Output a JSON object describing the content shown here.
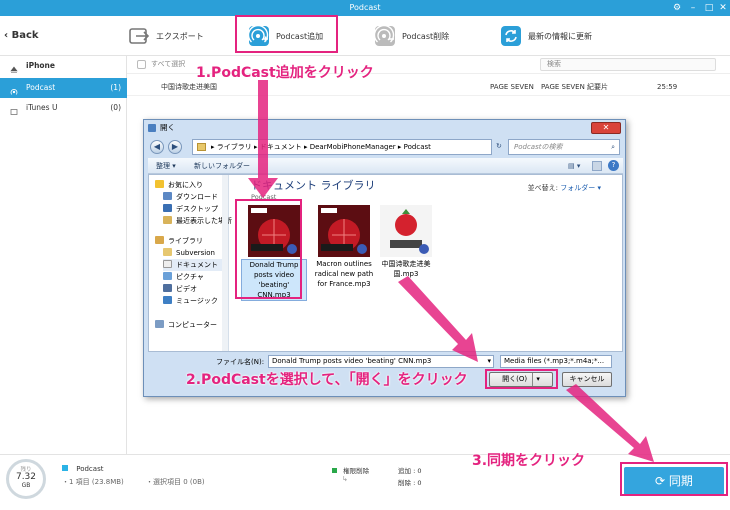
{
  "window": {
    "title": "Podcast"
  },
  "toolbar": {
    "back_label": "Back",
    "export_label": "エクスポート",
    "add_label": "Podcast追加",
    "delete_label": "Podcast削除",
    "refresh_label": "最新の情報に更新"
  },
  "sidebar": {
    "device": "iPhone",
    "items": [
      {
        "label": "Podcast",
        "count": "(1)"
      },
      {
        "label": "iTunes U",
        "count": "(0)"
      }
    ]
  },
  "list": {
    "select_all": "すべて選択",
    "search_placeholder": "検索",
    "rows": [
      {
        "title": "中国诗歌走进美国",
        "artist": "PAGE SEVEN",
        "album": "PAGE SEVEN 紀要片",
        "time": "25:59"
      }
    ]
  },
  "dialog": {
    "title": "開く",
    "path": [
      "ライブラリ",
      "ドキュメント",
      "DearMobiPhoneManager",
      "Podcast"
    ],
    "search_placeholder": "Podcastの検索",
    "organize": "整理 ▾",
    "new_folder": "新しいフォルダー",
    "nav": [
      "お気に入り",
      "ダウンロード",
      "デスクトップ",
      "最近表示した場所",
      "ライブラリ",
      "Subversion",
      "ドキュメント",
      "ピクチャ",
      "ビデオ",
      "ミュージック",
      "コンピューター"
    ],
    "library_title": "ドキュメント ライブラリ",
    "library_sub": "Podcast",
    "sort_label": "並べ替え:",
    "sort_value": "フォルダー ▾",
    "files": [
      {
        "name": "Donald Trump posts video 'beating' CNN.mp3",
        "selected": true
      },
      {
        "name": "Macron outlines radical new path for France.mp3",
        "selected": false
      },
      {
        "name": "中国诗歌走进美国.mp3",
        "selected": false
      }
    ],
    "filename_label": "ファイル名(N):",
    "filename_value": "Donald Trump posts video 'beating' CNN.mp3",
    "filetype_value": "Media files (*.mp3;*.m4a;*...",
    "open_label": "開く(O)",
    "cancel_label": "キャンセル",
    "close_label": "✕"
  },
  "status": {
    "gauge_top": "残り",
    "gauge_value": "7.32",
    "gauge_unit": "GB",
    "category": "Podcast",
    "items": "・1 項目 (23.8MB)",
    "selected": "・選択項目 0 (0B)",
    "legend1": "権限削除",
    "legend2": "追加 : 0",
    "legend3": "削除 : 0",
    "sync_label": "同期"
  },
  "annotations": {
    "step1": "1.PodCast追加をクリック",
    "step2": "2.PodCastを選択して、「開く」をクリック",
    "step3": "3.同期をクリック"
  },
  "colors": {
    "accent": "#2b9fd8",
    "annotation": "#e4237f"
  }
}
